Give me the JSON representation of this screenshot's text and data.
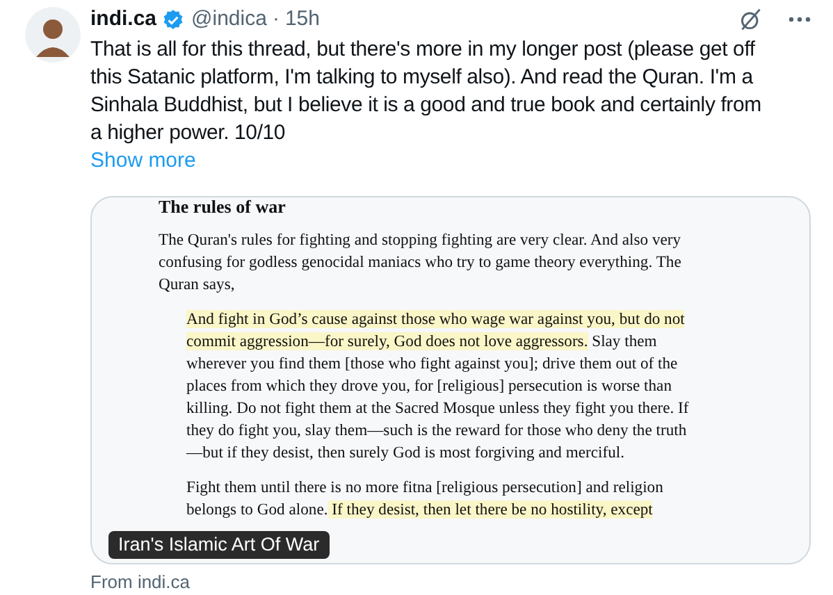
{
  "author": {
    "name": "indi.ca",
    "verified": true,
    "handle": "@indica",
    "separator": "·",
    "time": "15h"
  },
  "body": "That is all for this thread, but there's more in my longer post (please get off this Satanic platform, I'm talking to myself also). And read the Quran. I'm a Sinhala Buddhist, but I believe it is a good and true book and certainly from a higher power. 10/10",
  "show_more": "Show more",
  "card": {
    "document": {
      "heading": "The rules of war",
      "paragraphs": [
        {
          "kind": "plain",
          "segments": [
            {
              "text": "The Quran's rules for fighting and stopping fighting are very clear. And also very confusing for godless genocidal maniacs who try to game theory everything. The Quran says,",
              "highlighted": false
            }
          ]
        },
        {
          "kind": "quote",
          "segments": [
            {
              "text": "And fight in God’s cause against those who wage war against you, but do not commit aggression—for surely, God does not love aggressors.",
              "highlighted": true
            },
            {
              "text": " Slay them wherever you find them [those who fight against you]; drive them out of the places from which they drove you, for [religious] persecution is worse than killing. Do not fight them at the Sacred Mosque unless they fight you there. If they do fight you, slay them—such is the reward for those who deny the truth—but if they desist, then surely God is most forgiving and merciful.",
              "highlighted": false
            }
          ]
        },
        {
          "kind": "quote",
          "segments": [
            {
              "text": "Fight them until there is no more fitna [religious persecution] and religion belongs to God alone.",
              "highlighted": false
            },
            {
              "text": " If they desist, then let there be no hostility, except",
              "highlighted": true
            }
          ]
        }
      ]
    },
    "label": "Iran's Islamic Art Of War"
  },
  "source": "From indi.ca"
}
